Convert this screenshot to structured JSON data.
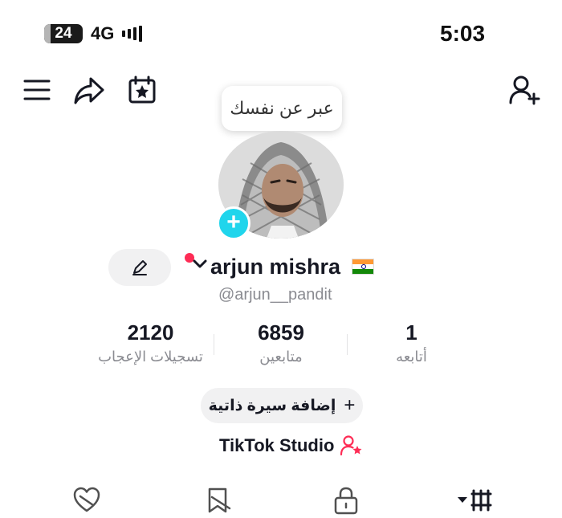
{
  "status_bar": {
    "battery": "24",
    "network": "4G",
    "time": "5:03"
  },
  "top_bar": {
    "icons": [
      "menu-icon",
      "share-icon",
      "calendar-star-icon",
      "add-friend-icon"
    ]
  },
  "profile": {
    "tooltip": "عبر عن نفسك",
    "avatar": "profile-photo",
    "username": "arjun mishra",
    "handle": "@arjun__pandit",
    "flag_colors": [
      "#ff9933",
      "#ffffff",
      "#138808"
    ]
  },
  "stats": {
    "likes": {
      "value": "2120",
      "label": "تسجيلات الإعجاب"
    },
    "followers": {
      "value": "6859",
      "label": "متابعين"
    },
    "following": {
      "value": "1",
      "label": "أتابعه"
    }
  },
  "bio_button": {
    "plus": "+",
    "label": "إضافة سيرة ذاتية"
  },
  "studio": {
    "label": "TikTok Studio"
  },
  "tabs": [
    "liked-heart-icon",
    "favorites-icon",
    "private-lock-icon",
    "videos-grid-icon"
  ],
  "colors": {
    "accent": "#fe2c55",
    "cyan": "#20d5ec",
    "muted": "#8a8b91"
  }
}
